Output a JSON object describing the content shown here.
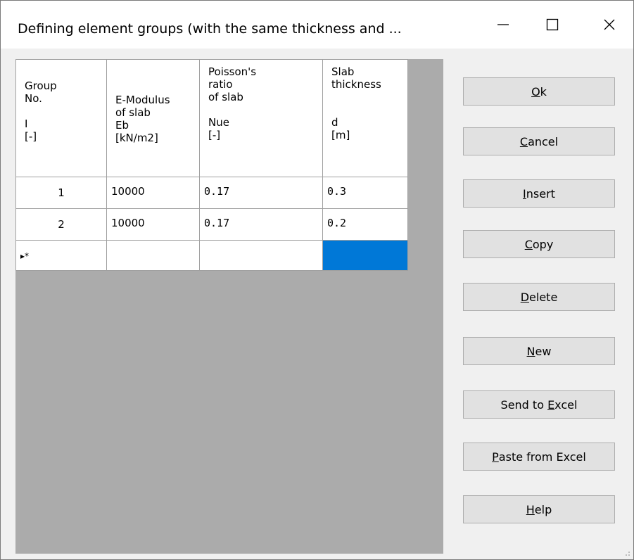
{
  "window": {
    "title": "Defining element groups  (with the same thickness and ...",
    "controls": {
      "minimize_icon": "minimize-icon",
      "maximize_icon": "maximize-icon",
      "close_icon": "close-icon"
    }
  },
  "grid": {
    "columns": [
      {
        "header": "Group\nNo.\n\nI\n[-]"
      },
      {
        "header": "E-Modulus\nof slab\nEb\n[kN/m2]"
      },
      {
        "header": "Poisson's\nratio\nof slab\n\nNue\n[-]"
      },
      {
        "header": "Slab\nthickness\n\n\nd\n[m]"
      }
    ],
    "rows": [
      {
        "no": "1",
        "e": "10000",
        "nue": "0.17",
        "d": "0.3"
      },
      {
        "no": "2",
        "e": "10000",
        "nue": "0.17",
        "d": "0.2"
      }
    ],
    "new_row_marker": "▸*"
  },
  "buttons": {
    "ok": {
      "pre": "",
      "key": "O",
      "post": "k"
    },
    "cancel": {
      "pre": "",
      "key": "C",
      "post": "ancel"
    },
    "insert": {
      "pre": "",
      "key": "I",
      "post": "nsert"
    },
    "copy": {
      "pre": "",
      "key": "C",
      "post": "opy"
    },
    "delete": {
      "pre": "",
      "key": "D",
      "post": "elete"
    },
    "new": {
      "pre": "",
      "key": "N",
      "post": "ew"
    },
    "send_excel": {
      "pre": "Send to ",
      "key": "E",
      "post": "xcel"
    },
    "paste_excel": {
      "pre": "",
      "key": "P",
      "post": "aste from Excel"
    },
    "help": {
      "pre": "",
      "key": "H",
      "post": "elp"
    }
  },
  "colors": {
    "selection": "#0078d7",
    "grid_background": "#ababab"
  }
}
